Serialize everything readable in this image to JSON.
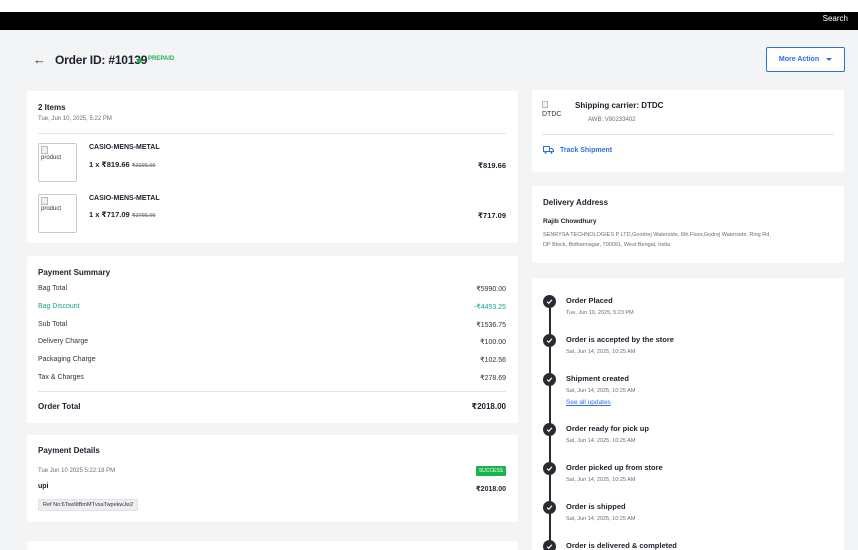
{
  "topbar": {
    "search": "Search"
  },
  "header": {
    "order_id": "Order ID: #10139",
    "payment_status": "PREPAID",
    "more_action": "More Action"
  },
  "items": {
    "count": "2 Items",
    "date": "Tue, Jun 10, 2025, 5:22 PM",
    "list": [
      {
        "image_alt": "product",
        "name": "CASIO-MENS-METAL",
        "qty_price": "1 x ₹819.66",
        "mrp": "₹3195.00",
        "total": "₹819.66"
      },
      {
        "image_alt": "product",
        "name": "CASIO-MENS-METAL",
        "qty_price": "1 x ₹717.09",
        "mrp": "₹2795.00",
        "total": "₹717.09"
      }
    ]
  },
  "payment_summary": {
    "title": "Payment Summary",
    "rows": [
      {
        "label": "Bag Total",
        "value": "₹5990.00"
      },
      {
        "label": "Bag Discount",
        "value": "-₹4453.25"
      },
      {
        "label": "Sub Total",
        "value": "₹1536.75"
      },
      {
        "label": "Delivery Charge",
        "value": "₹100.00"
      },
      {
        "label": "Packaging Charge",
        "value": "₹102.56"
      },
      {
        "label": "Tax & Charges",
        "value": "₹278.69"
      }
    ],
    "total_label": "Order Total",
    "total_value": "₹2018.00",
    "discount_color": "#19a58a"
  },
  "payment_details": {
    "title": "Payment Details",
    "date": "Tue Jun 10 2025 5:22:18 PM",
    "status": "SUCCESS",
    "method": "upi",
    "amount": "₹2018.00",
    "ref": "Ref No:6Tsw9tBmMTvsaTwpekwJw2"
  },
  "shipping": {
    "logo_alt": "DTDC",
    "carrier": "Shipping carrier: DTDC",
    "awb": "AWB: V80233402",
    "track": "Track Shipment"
  },
  "delivery": {
    "title": "Delivery Address",
    "name": "Rajib Chowdhury",
    "address_line1": "SENRYSA TECHNOLOGIES P LTD,Goodrej Waterside, 6th Floor,Godrej Waterside, Ring Rd,",
    "address_line2": "DP Block, Bidhannagar, 700091, West Bengal, India"
  },
  "timeline": [
    {
      "title": "Order Placed",
      "time": "Tue, Jun 10, 2025, 5:23 PM"
    },
    {
      "title": "Order is accepted by the store",
      "time": "Sat, Jun 14, 2025, 10:25 AM"
    },
    {
      "title": "Shipment created",
      "time": "Sat, Jun 14, 2025, 10:25 AM",
      "link": "See all updates"
    },
    {
      "title": "Order ready for pick up",
      "time": "Sat, Jun 14, 2025, 10:25 AM"
    },
    {
      "title": "Order picked up from store",
      "time": "Sat, Jun 14, 2025, 10:25 AM"
    },
    {
      "title": "Order is shipped",
      "time": "Sat, Jun 14, 2025, 10:25 AM"
    },
    {
      "title": "Order is delivered & completed",
      "time": ""
    }
  ],
  "colors": {
    "accent": "#2d6ee3",
    "success": "#19b44e",
    "timeline": "#2a2a33"
  }
}
